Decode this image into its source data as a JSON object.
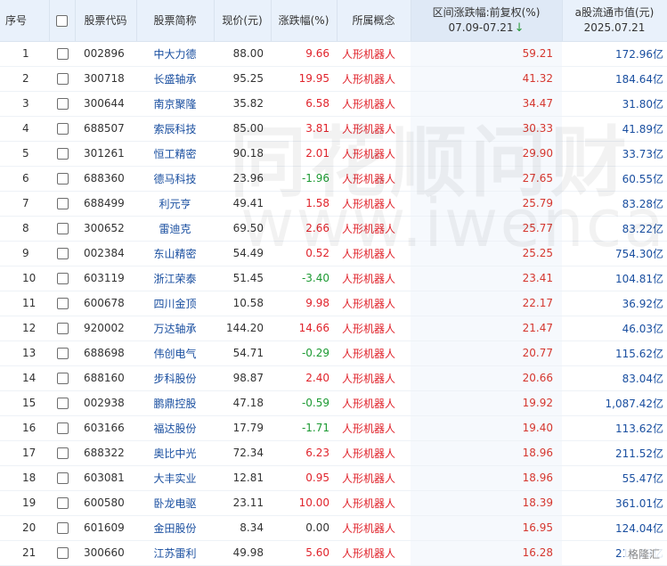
{
  "header": {
    "index": "序号",
    "code": "股票代码",
    "name": "股票简称",
    "price": "现价(元)",
    "change": "涨跌幅(%)",
    "concept": "所属概念",
    "range_line1": "区间涨跌幅:前复权(%)",
    "range_line2": "07.09-07.21",
    "sort_arrow": "↓",
    "cap_line1": "a股流通市值(元)",
    "cap_line2": "2025.07.21"
  },
  "rows": [
    {
      "idx": "1",
      "code": "002896",
      "name": "中大力德",
      "price": "88.00",
      "change": "9.66",
      "dir": "up",
      "concept": "人形机器人",
      "range": "59.21",
      "cap": "172.96亿"
    },
    {
      "idx": "2",
      "code": "300718",
      "name": "长盛轴承",
      "price": "95.25",
      "change": "19.95",
      "dir": "up",
      "concept": "人形机器人",
      "range": "41.32",
      "cap": "184.64亿"
    },
    {
      "idx": "3",
      "code": "300644",
      "name": "南京聚隆",
      "price": "35.82",
      "change": "6.58",
      "dir": "up",
      "concept": "人形机器人",
      "range": "34.47",
      "cap": "31.80亿"
    },
    {
      "idx": "4",
      "code": "688507",
      "name": "索辰科技",
      "price": "85.00",
      "change": "3.81",
      "dir": "up",
      "concept": "人形机器人",
      "range": "30.33",
      "cap": "41.89亿"
    },
    {
      "idx": "5",
      "code": "301261",
      "name": "恒工精密",
      "price": "90.18",
      "change": "2.01",
      "dir": "up",
      "concept": "人形机器人",
      "range": "29.90",
      "cap": "33.73亿"
    },
    {
      "idx": "6",
      "code": "688360",
      "name": "德马科技",
      "price": "23.96",
      "change": "-1.96",
      "dir": "down",
      "concept": "人形机器人",
      "range": "27.65",
      "cap": "60.55亿"
    },
    {
      "idx": "7",
      "code": "688499",
      "name": "利元亨",
      "price": "49.41",
      "change": "1.58",
      "dir": "up",
      "concept": "人形机器人",
      "range": "25.79",
      "cap": "83.28亿"
    },
    {
      "idx": "8",
      "code": "300652",
      "name": "雷迪克",
      "price": "69.50",
      "change": "2.66",
      "dir": "up",
      "concept": "人形机器人",
      "range": "25.77",
      "cap": "83.22亿"
    },
    {
      "idx": "9",
      "code": "002384",
      "name": "东山精密",
      "price": "54.49",
      "change": "0.52",
      "dir": "up",
      "concept": "人形机器人",
      "range": "25.25",
      "cap": "754.30亿"
    },
    {
      "idx": "10",
      "code": "603119",
      "name": "浙江荣泰",
      "price": "51.45",
      "change": "-3.40",
      "dir": "down",
      "concept": "人形机器人",
      "range": "23.41",
      "cap": "104.81亿"
    },
    {
      "idx": "11",
      "code": "600678",
      "name": "四川金顶",
      "price": "10.58",
      "change": "9.98",
      "dir": "up",
      "concept": "人形机器人",
      "range": "22.17",
      "cap": "36.92亿"
    },
    {
      "idx": "12",
      "code": "920002",
      "name": "万达轴承",
      "price": "144.20",
      "change": "14.66",
      "dir": "up",
      "concept": "人形机器人",
      "range": "21.47",
      "cap": "46.03亿"
    },
    {
      "idx": "13",
      "code": "688698",
      "name": "伟创电气",
      "price": "54.71",
      "change": "-0.29",
      "dir": "down",
      "concept": "人形机器人",
      "range": "20.77",
      "cap": "115.62亿"
    },
    {
      "idx": "14",
      "code": "688160",
      "name": "步科股份",
      "price": "98.87",
      "change": "2.40",
      "dir": "up",
      "concept": "人形机器人",
      "range": "20.66",
      "cap": "83.04亿"
    },
    {
      "idx": "15",
      "code": "002938",
      "name": "鹏鼎控股",
      "price": "47.18",
      "change": "-0.59",
      "dir": "down",
      "concept": "人形机器人",
      "range": "19.92",
      "cap": "1,087.42亿"
    },
    {
      "idx": "16",
      "code": "603166",
      "name": "福达股份",
      "price": "17.79",
      "change": "-1.71",
      "dir": "down",
      "concept": "人形机器人",
      "range": "19.40",
      "cap": "113.62亿"
    },
    {
      "idx": "17",
      "code": "688322",
      "name": "奥比中光",
      "price": "72.34",
      "change": "6.23",
      "dir": "up",
      "concept": "人形机器人",
      "range": "18.96",
      "cap": "211.52亿"
    },
    {
      "idx": "18",
      "code": "603081",
      "name": "大丰实业",
      "price": "12.81",
      "change": "0.95",
      "dir": "up",
      "concept": "人形机器人",
      "range": "18.96",
      "cap": "55.47亿"
    },
    {
      "idx": "19",
      "code": "600580",
      "name": "卧龙电驱",
      "price": "23.11",
      "change": "10.00",
      "dir": "up",
      "concept": "人形机器人",
      "range": "18.39",
      "cap": "361.01亿"
    },
    {
      "idx": "20",
      "code": "601609",
      "name": "金田股份",
      "price": "8.34",
      "change": "0.00",
      "dir": "flat",
      "concept": "人形机器人",
      "range": "16.95",
      "cap": "124.04亿"
    },
    {
      "idx": "21",
      "code": "300660",
      "name": "江苏雷利",
      "price": "49.98",
      "change": "5.60",
      "dir": "up",
      "concept": "人形机器人",
      "range": "16.28",
      "cap": "216.29亿"
    }
  ],
  "watermark": {
    "chinese": "同花顺问财",
    "english": "www.iwencai.com"
  },
  "corner_logo": "格隆汇"
}
